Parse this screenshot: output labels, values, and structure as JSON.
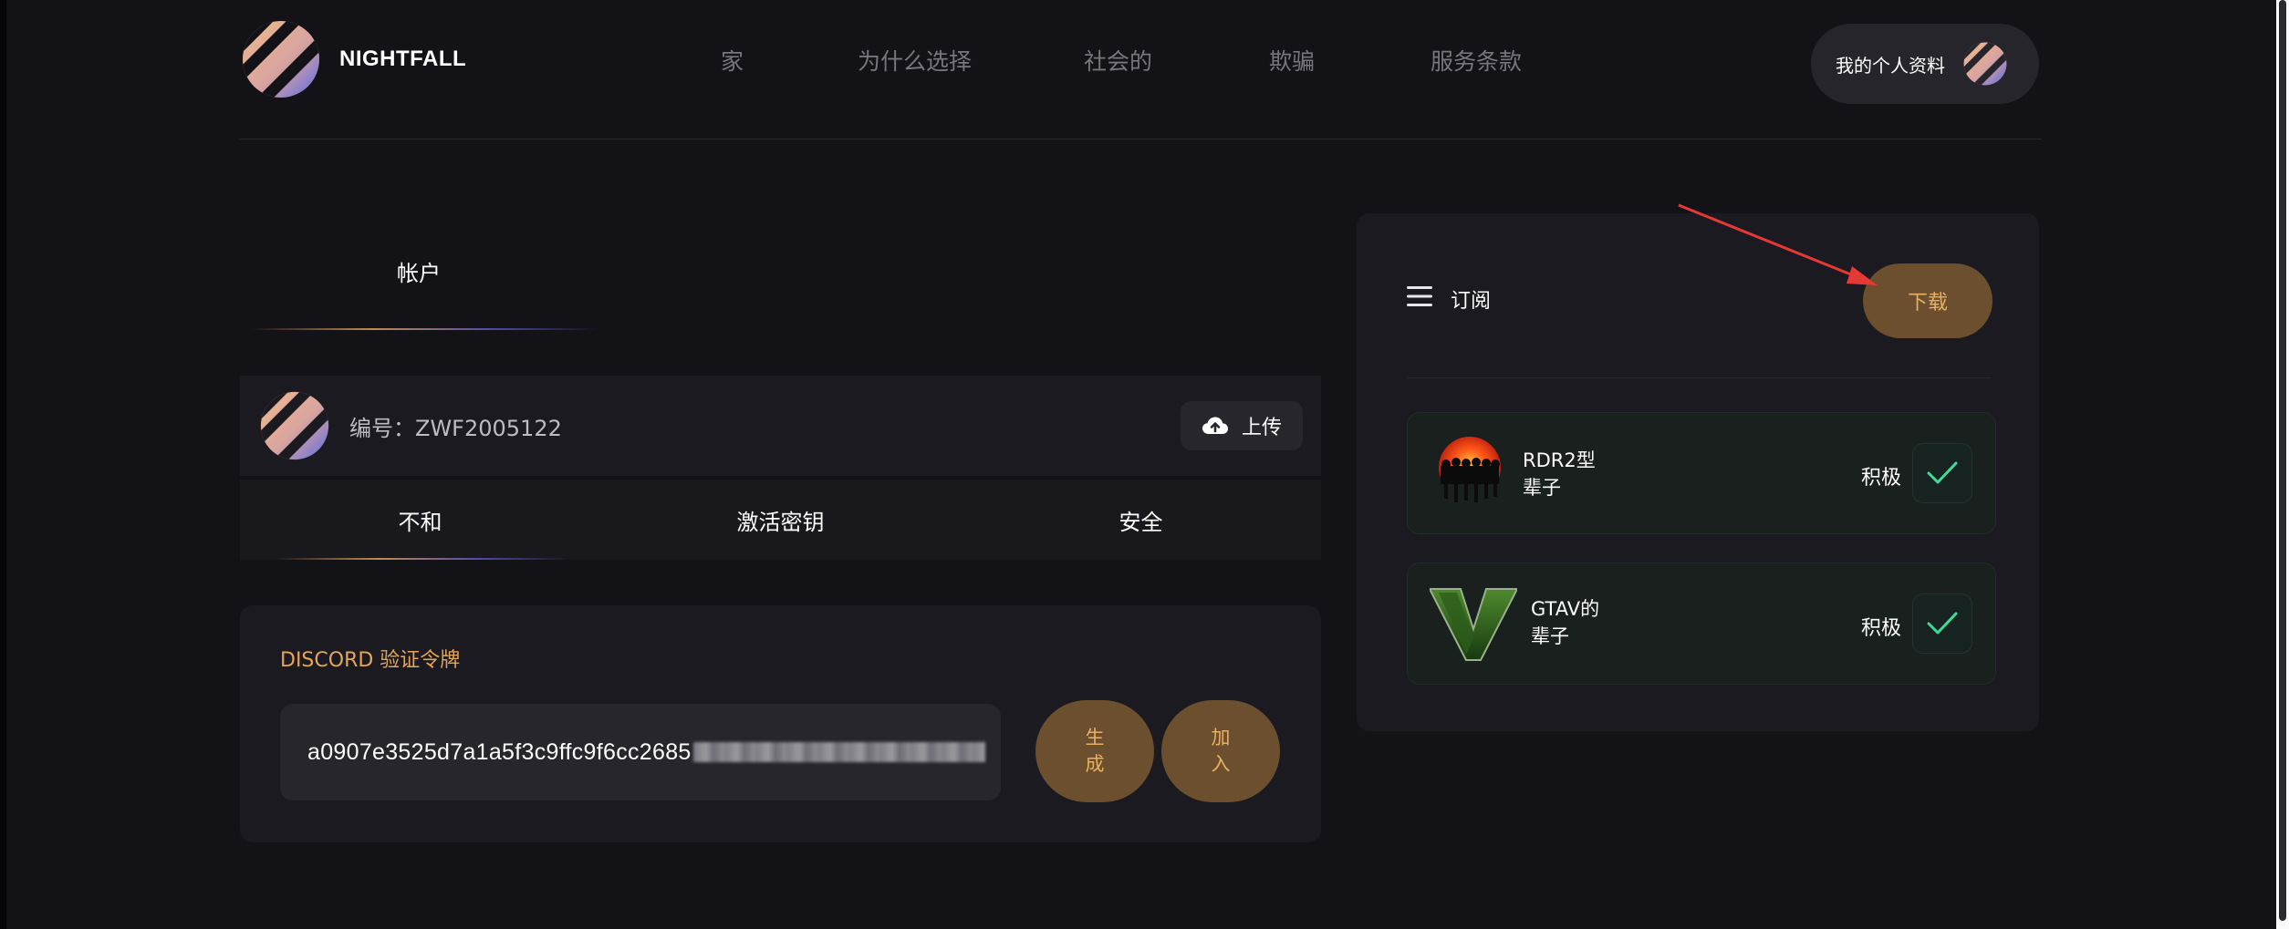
{
  "brand": {
    "name": "NIGHTFALL",
    "logo_icon": "striped-globe-icon"
  },
  "nav": {
    "items": [
      {
        "label": "家"
      },
      {
        "label": "为什么选择"
      },
      {
        "label": "社会的"
      },
      {
        "label": "欺骗"
      },
      {
        "label": "服务条款"
      }
    ]
  },
  "profile": {
    "label": "我的个人资料",
    "avatar_icon": "striped-globe-icon"
  },
  "account": {
    "tab_label": "帐户",
    "id_text": "编号：ZWF2005122",
    "upload_label": "上传",
    "upload_icon": "cloud-upload-icon"
  },
  "subtabs": [
    {
      "label": "不和"
    },
    {
      "label": "激活密钥"
    },
    {
      "label": "安全"
    }
  ],
  "token": {
    "title": "DISCORD 验证令牌",
    "value_visible": "a0907e3525d7a1a5f3c9ffc9f6cc2685",
    "generate_label": "生成",
    "join_label": "加入"
  },
  "subscriptions": {
    "title": "订阅",
    "menu_icon": "hamburger-menu-icon",
    "download_label": "下载",
    "items": [
      {
        "name": "RDR2型",
        "duration": "辈子",
        "status": "积极",
        "thumb_icon": "red-dead-sunset-icon",
        "check_icon": "check-icon"
      },
      {
        "name": "GTAV的",
        "duration": "辈子",
        "status": "积极",
        "thumb_icon": "gta-v-logo-icon",
        "check_icon": "check-icon"
      }
    ]
  },
  "colors": {
    "background": "#131217",
    "panel": "#1b1a20",
    "accent_text": "#e8b063",
    "accent_button": "#6b4f2e",
    "check_green": "#3ddc97",
    "annotation_red": "#e53935"
  }
}
